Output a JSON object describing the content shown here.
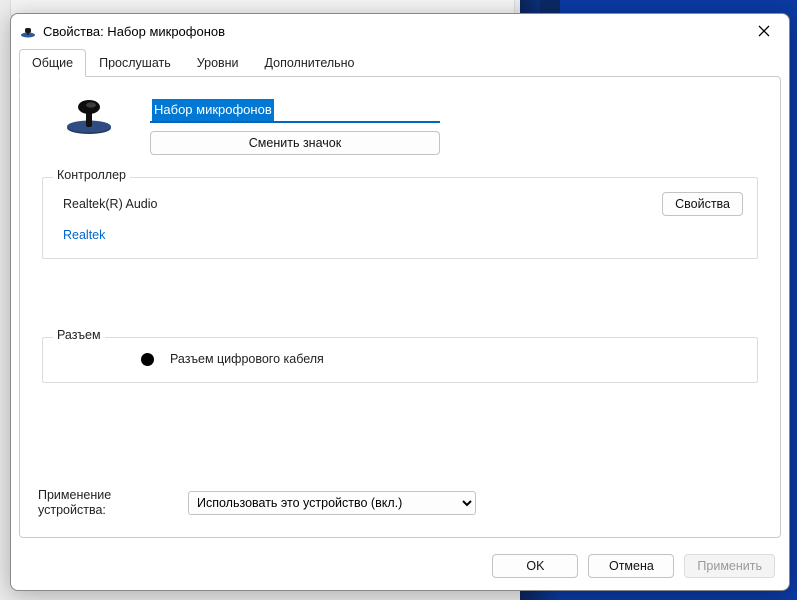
{
  "window": {
    "title": "Свойства: Набор микрофонов"
  },
  "tabs": [
    {
      "label": "Общие"
    },
    {
      "label": "Прослушать"
    },
    {
      "label": "Уровни"
    },
    {
      "label": "Дополнительно"
    }
  ],
  "device": {
    "name": "Набор микрофонов",
    "change_icon_label": "Сменить значок"
  },
  "controller": {
    "group_label": "Контроллер",
    "name": "Realtek(R) Audio",
    "link": "Realtek",
    "properties_button": "Свойства"
  },
  "jack": {
    "group_label": "Разъем",
    "description": "Разъем цифрового кабеля"
  },
  "usage": {
    "label": "Применение устройства:",
    "selected": "Использовать это устройство (вкл.)"
  },
  "footer": {
    "ok": "OK",
    "cancel": "Отмена",
    "apply": "Применить"
  }
}
